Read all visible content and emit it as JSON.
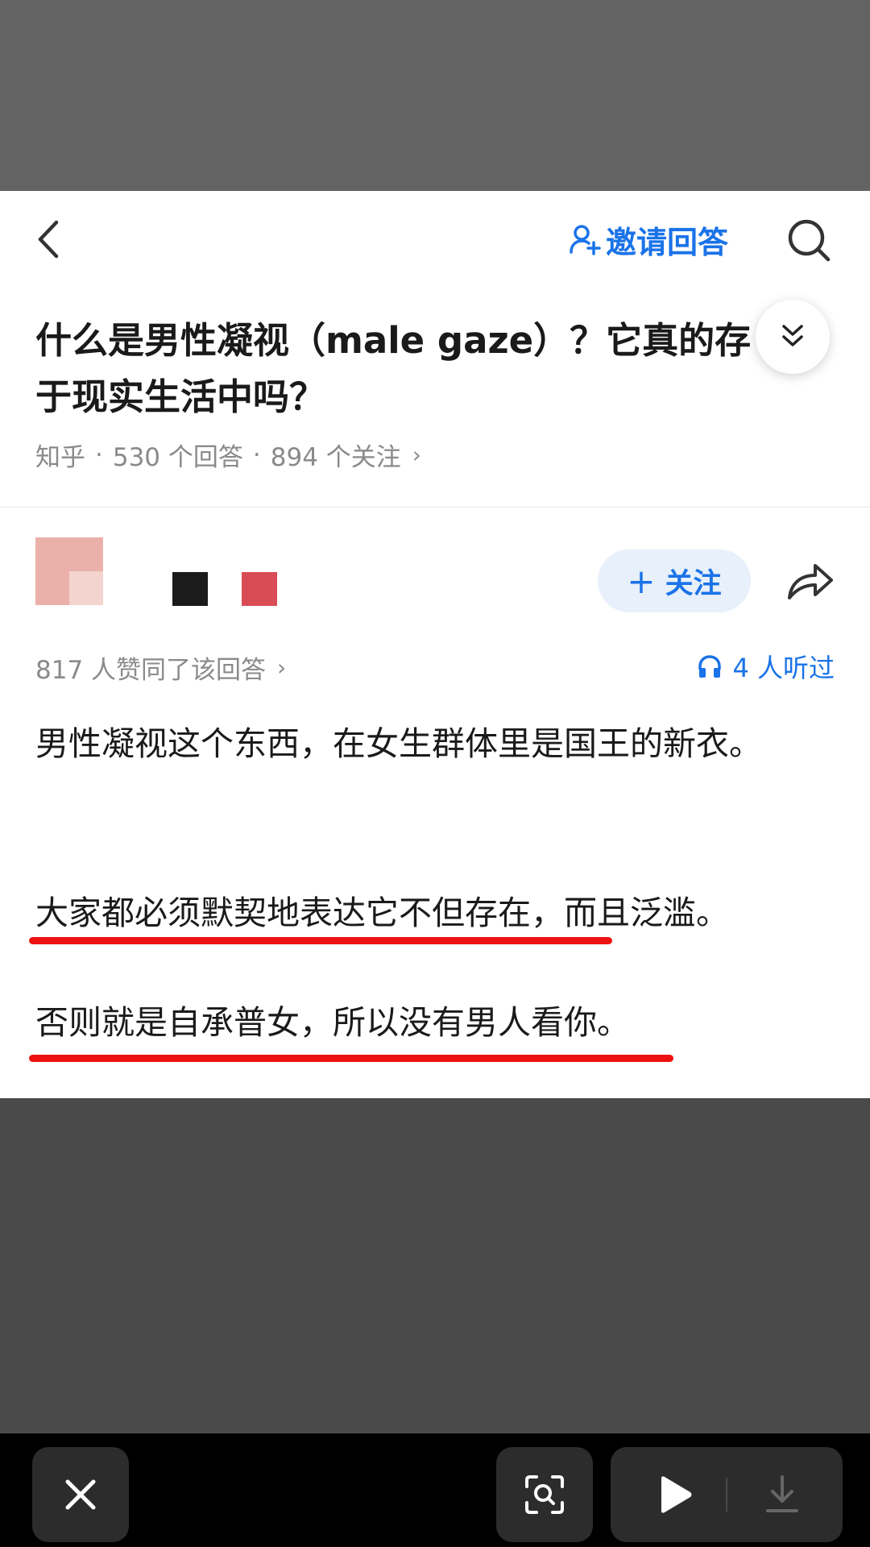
{
  "header": {
    "invite_label": "邀请回答"
  },
  "question": {
    "title": "什么是男性凝视（male gaze）？它真的存\n于现实生活中吗？",
    "source": "知乎",
    "answers": "530 个回答",
    "followers": "894 个关注"
  },
  "answer": {
    "follow_label": "关注",
    "likes_text": "817 人赞同了该回答",
    "listened_text": "4 人听过",
    "paragraphs": [
      "男性凝视这个东西，在女生群体里是国王的新衣。",
      "大家都必须默契地表达它不但存在，而且泛滥。",
      "否则就是自承普女，所以没有男人看你。"
    ]
  },
  "colors": {
    "accent": "#1a73e8",
    "underline": "#ee1111",
    "backdrop_top": "#636363",
    "backdrop_bottom": "#4a4a4a"
  },
  "icons": {
    "back": "chevron-left-icon",
    "invite": "person-add-icon",
    "search": "search-icon",
    "expand": "double-chevron-down-icon",
    "share": "share-arrow-icon",
    "listen": "headphones-icon",
    "close": "close-icon",
    "scan": "scan-search-icon",
    "play": "play-icon",
    "download": "download-icon"
  }
}
